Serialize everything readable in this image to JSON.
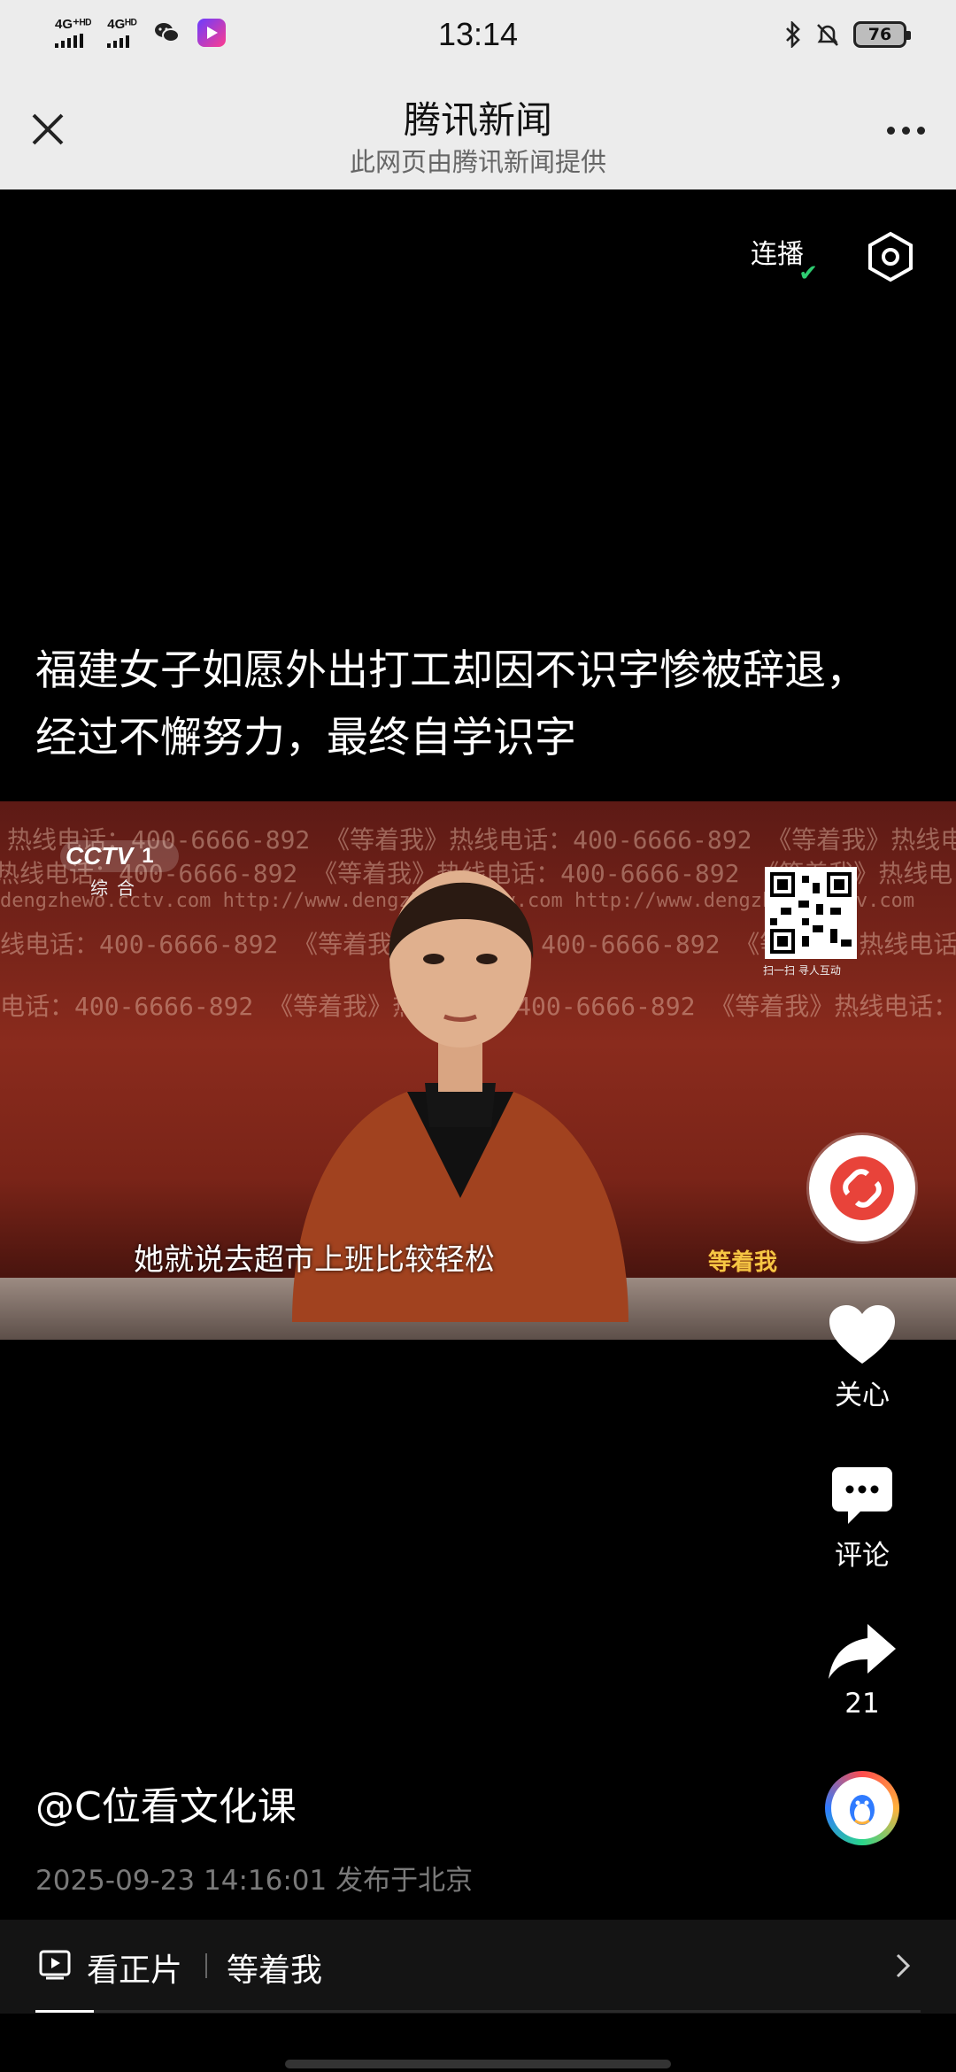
{
  "status_bar": {
    "network1": "4G⁺ᴴᴰ",
    "network2": "4Gᴴᴰ",
    "time": "13:14",
    "battery": "76"
  },
  "header": {
    "title": "腾讯新闻",
    "subtitle": "此网页由腾讯新闻提供"
  },
  "overlay": {
    "lianbo_label": "连播"
  },
  "article": {
    "headline": "福建女子如愿外出打工却因不识字惨被辞退，经过不懈努力，最终自学识字"
  },
  "video": {
    "channel": "CCTV",
    "channel_num": "1",
    "channel_sub": "综合",
    "subtitle": "她就说去超市上班比较轻松",
    "bg_lines": [
      "热线电话：400-6666-892  《等着我》热线电话：400-6666-892  《等着我》热线电话",
      "热线电话：400-6666-892  《等着我》热线电话：400-6666-892  《等着我》热线电",
      "dengzhewo.cctv.com    http://www.dengzhewo.cctv.com    http://www.dengzhewo.cctv.com",
      "线电话：400-6666-892  《等着我》热线电话：400-6666-892  《等着我》热线电话：",
      "电话：400-6666-892  《等着我》热线电话：400-6666-892  《等着我》热线电话：400-6666"
    ],
    "qr_caption": "扫一扫  寻人互动",
    "show_logo": "等着我"
  },
  "actions": {
    "follow_label": "关心",
    "comment_label": "评论",
    "share_count": "21"
  },
  "author": {
    "handle": "@C位看文化课",
    "meta": "2025-09-23 14:16:01 发布于北京"
  },
  "bottom_bar": {
    "watch_label": "看正片",
    "show_name": "等着我",
    "progress": 0.066
  }
}
